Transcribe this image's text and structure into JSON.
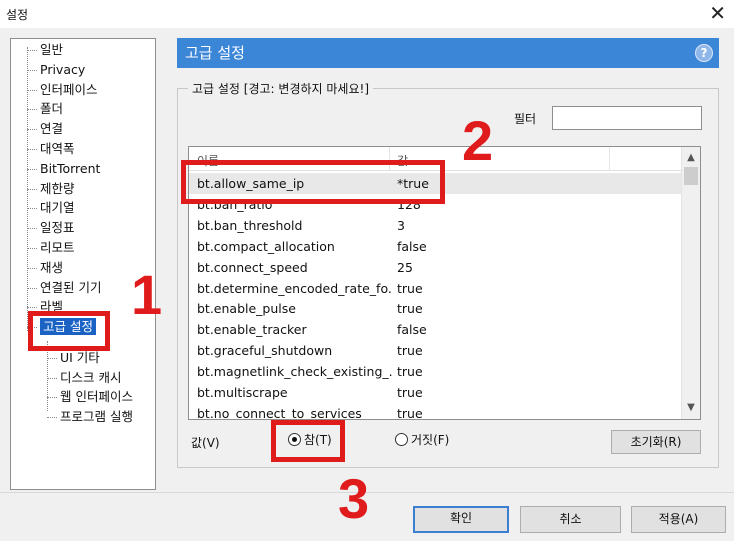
{
  "window": {
    "title": "설정",
    "close_glyph": "✕"
  },
  "tree": {
    "items": [
      {
        "label": "일반"
      },
      {
        "label": "Privacy"
      },
      {
        "label": "인터페이스"
      },
      {
        "label": "폴더"
      },
      {
        "label": "연결"
      },
      {
        "label": "대역폭"
      },
      {
        "label": "BitTorrent"
      },
      {
        "label": "제한량"
      },
      {
        "label": "대기열"
      },
      {
        "label": "일정표"
      },
      {
        "label": "리모트"
      },
      {
        "label": "재생"
      },
      {
        "label": "연결된 기기"
      },
      {
        "label": "라벨"
      },
      {
        "label": "고급 설정"
      }
    ],
    "sub_items": [
      {
        "label": "UI 기타"
      },
      {
        "label": "디스크 캐시"
      },
      {
        "label": "웹 인터페이스"
      },
      {
        "label": "프로그램 실행"
      }
    ],
    "selected": "고급 설정"
  },
  "header": {
    "title": "고급 설정",
    "help_glyph": "?"
  },
  "group": {
    "title": "고급 설정 [경고: 변경하지 마세요!]"
  },
  "filter": {
    "label": "필터",
    "value": ""
  },
  "list": {
    "columns": [
      "이름",
      "값"
    ],
    "rows": [
      {
        "name": "bt.allow_same_ip",
        "value": "*true"
      },
      {
        "name": "bt.ban_ratio",
        "value": "128"
      },
      {
        "name": "bt.ban_threshold",
        "value": "3"
      },
      {
        "name": "bt.compact_allocation",
        "value": "false"
      },
      {
        "name": "bt.connect_speed",
        "value": "25"
      },
      {
        "name": "bt.determine_encoded_rate_fo...",
        "value": "true"
      },
      {
        "name": "bt.enable_pulse",
        "value": "true"
      },
      {
        "name": "bt.enable_tracker",
        "value": "false"
      },
      {
        "name": "bt.graceful_shutdown",
        "value": "true"
      },
      {
        "name": "bt.magnetlink_check_existing_...",
        "value": "true"
      },
      {
        "name": "bt.multiscrape",
        "value": "true"
      },
      {
        "name": "bt.no_connect_to_services",
        "value": "true"
      }
    ],
    "selected_index": 0
  },
  "value_row": {
    "label": "값(V)",
    "true_label": "참(T)",
    "false_label": "거짓(F)",
    "selected": "참(T)",
    "reset_label": "초기화(R)"
  },
  "footer": {
    "ok": "확인",
    "cancel": "취소",
    "apply": "적용(A)"
  },
  "annotations": {
    "step1": "1",
    "step2": "2",
    "step3": "3",
    "color": "#e01b1b"
  },
  "icons": {
    "scroll_up": "▲",
    "scroll_down": "▼"
  }
}
